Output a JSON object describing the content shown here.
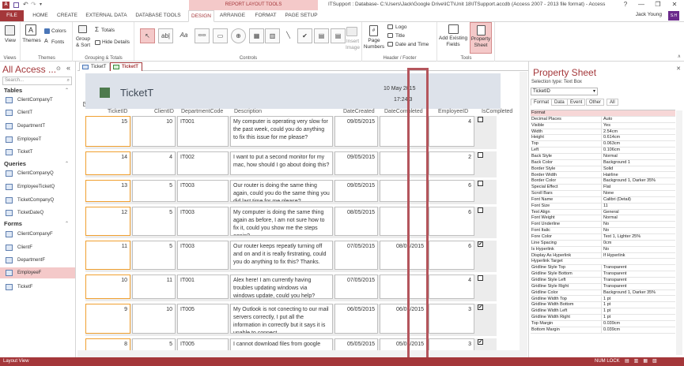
{
  "titlebar": {
    "context_tab": "REPORT LAYOUT TOOLS",
    "title": "ITSupport : Database- C:\\Users\\Jack\\Google Drive\\ICT\\Unit 18\\ITSupport.accdb (Access 2007 - 2013 file format) - Access",
    "help": "?",
    "minimize": "—",
    "restore": "❐",
    "close": "✕"
  },
  "ribbon_tabs": [
    "FILE",
    "HOME",
    "CREATE",
    "EXTERNAL DATA",
    "DATABASE TOOLS",
    "DESIGN",
    "ARRANGE",
    "FORMAT",
    "PAGE SETUP"
  ],
  "user": {
    "name": "Jack Young",
    "initials": "S.H"
  },
  "ribbon": {
    "views": {
      "label": "View",
      "group": "Views"
    },
    "themes": {
      "themes": "Themes",
      "colors": "Colors",
      "fonts": "Fonts",
      "group": "Themes"
    },
    "grouping": {
      "group_sort": "Group & Sort",
      "totals": "Totals",
      "hide_details": "Hide Details",
      "group": "Grouping & Totals"
    },
    "controls": {
      "group": "Controls"
    },
    "insert_image": "Insert Image",
    "header_footer": {
      "page_numbers": "Page Numbers",
      "logo": "Logo",
      "title": "Title",
      "date_time": "Date and Time",
      "group": "Header / Footer"
    },
    "tools": {
      "add_fields": "Add Existing Fields",
      "property_sheet": "Property Sheet",
      "group": "Tools"
    }
  },
  "nav": {
    "title": "All Access ...",
    "search_placeholder": "Search...",
    "sections": [
      {
        "title": "Tables",
        "items": [
          "ClientCompanyT",
          "ClientT",
          "DepartmentT",
          "EmployeeT",
          "TicketT"
        ]
      },
      {
        "title": "Queries",
        "items": [
          "ClientCompanyQ",
          "EmployeeTicketQ",
          "TicketCompanyQ",
          "TicketDateQ"
        ]
      },
      {
        "title": "Forms",
        "items": [
          "ClientCompanyF",
          "ClientF",
          "DepartmentF",
          "EmployeeF",
          "TicketF"
        ]
      }
    ],
    "selected": "EmployeeF"
  },
  "doc_tabs": [
    "TicketT",
    "TicketT"
  ],
  "report": {
    "title": "TicketT",
    "date": "10 May 2015",
    "time": "17:24:3",
    "columns": [
      "TicketID",
      "ClientID",
      "DepartmentCode",
      "Description",
      "DateCreated",
      "DateCompleted",
      "EmployeeID",
      "IsCompleted"
    ],
    "rows": [
      {
        "TicketID": "15",
        "ClientID": "10",
        "DepartmentCode": "IT001",
        "Description": "My computer is operating very slow for the past week, could you do anything to fix this issue for me please?",
        "DateCreated": "09/05/2015",
        "DateCompleted": "",
        "EmployeeID": "4",
        "IsCompleted": false
      },
      {
        "TicketID": "14",
        "ClientID": "4",
        "DepartmentCode": "IT002",
        "Description": "I want to put a second monitor for my mac, how should I go about doing this?",
        "DateCreated": "09/05/2015",
        "DateCompleted": "",
        "EmployeeID": "2",
        "IsCompleted": false
      },
      {
        "TicketID": "13",
        "ClientID": "5",
        "DepartmentCode": "IT003",
        "Description": "Our router is doing the same thing again, could you do the same thing you did last time for me please?",
        "DateCreated": "09/05/2015",
        "DateCompleted": "",
        "EmployeeID": "6",
        "IsCompleted": false
      },
      {
        "TicketID": "12",
        "ClientID": "5",
        "DepartmentCode": "IT003",
        "Description": "My computer is doing the same thing again as before, I am not sure how to fix it, could you show me the steps again?",
        "DateCreated": "08/05/2015",
        "DateCompleted": "",
        "EmployeeID": "6",
        "IsCompleted": false
      },
      {
        "TicketID": "11",
        "ClientID": "5",
        "DepartmentCode": "IT003",
        "Description": "Our router keeps repeatly turning off and on and it is really firstrating, could you do anything to fix this? Thanks.",
        "DateCreated": "07/05/2015",
        "DateCompleted": "08/05/2015",
        "EmployeeID": "6",
        "IsCompleted": true
      },
      {
        "TicketID": "10",
        "ClientID": "11",
        "DepartmentCode": "IT001",
        "Description": "Alex here! I am currently having troubles updating windows via windows update, could you help?",
        "DateCreated": "07/05/2015",
        "DateCompleted": "",
        "EmployeeID": "4",
        "IsCompleted": false
      },
      {
        "TicketID": "9",
        "ClientID": "10",
        "DepartmentCode": "IT005",
        "Description": "My Outlook is not conecting to our mail servers correctly, I put all the information in correctly but it says it is unable to connect.",
        "DateCreated": "06/05/2015",
        "DateCompleted": "06/05/2015",
        "EmployeeID": "3",
        "IsCompleted": true
      },
      {
        "TicketID": "8",
        "ClientID": "5",
        "DepartmentCode": "IT005",
        "Description": "I cannot download files from google",
        "DateCreated": "05/05/2015",
        "DateCompleted": "05/05/2015",
        "EmployeeID": "3",
        "IsCompleted": true
      }
    ]
  },
  "property_sheet": {
    "title": "Property Sheet",
    "selection_type": "Selection type: Text Box",
    "selected_control": "TicketID",
    "tabs": [
      "Format",
      "Data",
      "Event",
      "Other",
      "All"
    ],
    "properties": [
      [
        "Format",
        ""
      ],
      [
        "Decimal Places",
        "Auto"
      ],
      [
        "Visible",
        "Yes"
      ],
      [
        "Width",
        "2.54cm"
      ],
      [
        "Height",
        "0.614cm"
      ],
      [
        "Top",
        "0.063cm"
      ],
      [
        "Left",
        "0.106cm"
      ],
      [
        "Back Style",
        "Normal"
      ],
      [
        "Back Color",
        "Background 1"
      ],
      [
        "Border Style",
        "Solid"
      ],
      [
        "Border Width",
        "Hairline"
      ],
      [
        "Border Color",
        "Background 1, Darker 35%"
      ],
      [
        "Special Effect",
        "Flat"
      ],
      [
        "Scroll Bars",
        "None"
      ],
      [
        "Font Name",
        "Calibri (Detail)"
      ],
      [
        "Font Size",
        "11"
      ],
      [
        "Text Align",
        "General"
      ],
      [
        "Font Weight",
        "Normal"
      ],
      [
        "Font Underline",
        "No"
      ],
      [
        "Font Italic",
        "No"
      ],
      [
        "Fore Color",
        "Text 1, Lighter 25%"
      ],
      [
        "Line Spacing",
        "0cm"
      ],
      [
        "Is Hyperlink",
        "No"
      ],
      [
        "Display As Hyperlink",
        "If Hyperlink"
      ],
      [
        "Hyperlink Target",
        ""
      ],
      [
        "Gridline Style Top",
        "Transparent"
      ],
      [
        "Gridline Style Bottom",
        "Transparent"
      ],
      [
        "Gridline Style Left",
        "Transparent"
      ],
      [
        "Gridline Style Right",
        "Transparent"
      ],
      [
        "Gridline Color",
        "Background 1, Darker 35%"
      ],
      [
        "Gridline Width Top",
        "1 pt"
      ],
      [
        "Gridline Width Bottom",
        "1 pt"
      ],
      [
        "Gridline Width Left",
        "1 pt"
      ],
      [
        "Gridline Width Right",
        "1 pt"
      ],
      [
        "Top Margin",
        "0.039cm"
      ],
      [
        "Bottom Margin",
        "0.039cm"
      ]
    ]
  },
  "status": {
    "left": "Layout View",
    "right": "NUM LOCK"
  },
  "colors": {
    "accent": "#a4373a",
    "selected_nav": "#f4c9c9",
    "header_band": "#dde2ea"
  }
}
